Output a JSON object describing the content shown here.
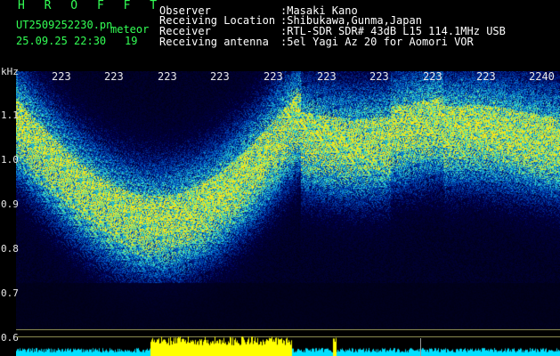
{
  "header": {
    "title": "H R O F F T",
    "filename": "UT2509252230.pn",
    "meteor_label": "meteor",
    "datetime": "25.09.25 22:30",
    "count": "19",
    "fields": [
      {
        "label": "Observer",
        "value": ":Masaki Kano"
      },
      {
        "label": "Receiving Location",
        "value": ":Shibukawa,Gunma,Japan"
      },
      {
        "label": "Receiver",
        "value": ":RTL-SDR SDR# 43dB L15 114.1MHz USB"
      },
      {
        "label": "Receiving antenna",
        "value": ":5el Yagi Az 20 for Aomori VOR"
      }
    ]
  },
  "time_axis": {
    "ticks": [
      "223",
      "223",
      "223",
      "223",
      "223",
      "223",
      "223",
      "223",
      "223",
      "2240"
    ]
  },
  "freq_axis": {
    "unit": "kHz",
    "labels": [
      "1.1",
      "1.0",
      "0.9",
      "0.8",
      "0.7",
      "0.6"
    ]
  },
  "colors": {
    "background": "#000000",
    "header_text": "#ffffff",
    "title_text": "#33ff55",
    "waterfall_low": "#001a66",
    "waterfall_mid": "#20c0ff",
    "waterfall_high": "#ffff40",
    "level_cyan": "#00e0ff",
    "level_yellow": "#ffff00"
  }
}
